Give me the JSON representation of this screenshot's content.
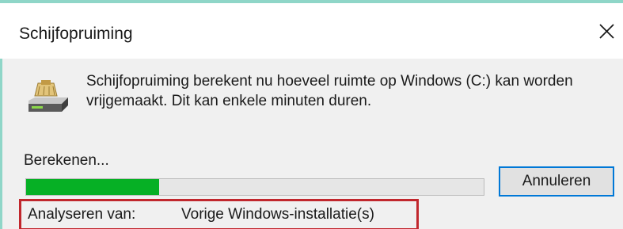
{
  "window": {
    "title": "Schijfopruiming",
    "close_icon": "close-icon"
  },
  "message": {
    "icon": "disk-cleanup-icon",
    "text": "Schijfopruiming berekent nu hoeveel ruimte op Windows (C:) kan worden vrijgemaakt. Dit kan enkele minuten duren."
  },
  "progress": {
    "label": "Berekenen...",
    "percent": 29,
    "fill_color": "#06b025"
  },
  "buttons": {
    "cancel_label": "Annuleren"
  },
  "analysis": {
    "label": "Analyseren van:",
    "value": "Vorige Windows-installatie(s)",
    "highlight_color": "#c1272d"
  }
}
